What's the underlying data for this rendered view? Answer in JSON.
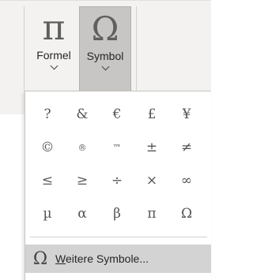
{
  "ribbon": {
    "formel": {
      "icon": "π",
      "label": "Formel"
    },
    "symbol": {
      "icon": "Ω",
      "label": "Symbol"
    }
  },
  "dropdown": {
    "symbols": [
      "?",
      "&",
      "€",
      "£",
      "¥",
      "©",
      "®",
      "™",
      "±",
      "≠",
      "≤",
      "≥",
      "÷",
      "×",
      "∞",
      "µ",
      "α",
      "β",
      "π",
      "Ω"
    ],
    "more": {
      "icon": "Ω",
      "accesskey": "W",
      "label_rest": "eitere Symbole..."
    }
  }
}
